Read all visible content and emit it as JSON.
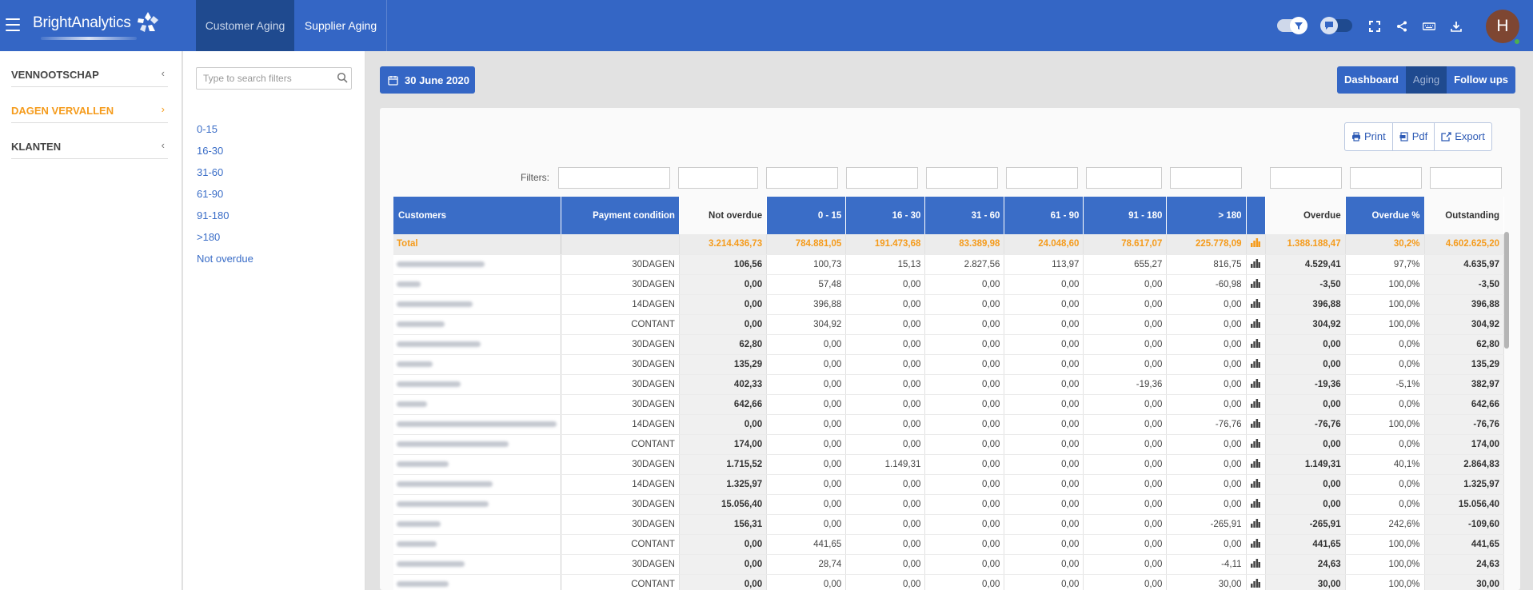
{
  "app": {
    "brand": "BrightAnalytics"
  },
  "nav": {
    "tabs": [
      {
        "label": "Customer Aging"
      },
      {
        "label": "Supplier Aging"
      }
    ]
  },
  "user": {
    "initial": "H"
  },
  "colors": {
    "primary": "#3466c5",
    "primary_dark": "#1f4a8f",
    "accent": "#f59b1b"
  },
  "sidebar": {
    "items": [
      {
        "label": "VENNOOTSCHAP",
        "chevron": "‹"
      },
      {
        "label": "DAGEN VERVALLEN",
        "chevron": "›"
      },
      {
        "label": "KLANTEN",
        "chevron": "‹"
      }
    ]
  },
  "filter_panel": {
    "search_placeholder": "Type to search filters",
    "options": [
      "0-15",
      "16-30",
      "31-60",
      "61-90",
      "91-180",
      ">180",
      "Not overdue"
    ]
  },
  "date_button": {
    "label": "30 June 2020"
  },
  "view_switch": {
    "items": [
      "Dashboard",
      "Aging",
      "Follow ups"
    ],
    "selected": "Aging"
  },
  "actions": {
    "print": "Print",
    "pdf": "Pdf",
    "export": "Export"
  },
  "filters_label": "Filters:",
  "table": {
    "columns": [
      "Customers",
      "Payment condition",
      "Not overdue",
      "0 - 15",
      "16 - 30",
      "31 - 60",
      "61 - 90",
      "91 - 180",
      "> 180",
      "",
      "Overdue",
      "Overdue %",
      "Outstanding"
    ],
    "total": {
      "label": "Total",
      "values": [
        "",
        "3.214.436,73",
        "784.881,05",
        "191.473,68",
        "83.389,98",
        "24.048,60",
        "78.617,07",
        "225.778,09",
        "1.388.188,47",
        "30,2%",
        "4.602.625,20"
      ]
    },
    "rows": [
      [
        "30DAGEN",
        "106,56",
        "100,73",
        "15,13",
        "2.827,56",
        "113,97",
        "655,27",
        "816,75",
        "4.529,41",
        "97,7%",
        "4.635,97"
      ],
      [
        "30DAGEN",
        "0,00",
        "57,48",
        "0,00",
        "0,00",
        "0,00",
        "0,00",
        "-60,98",
        "-3,50",
        "100,0%",
        "-3,50"
      ],
      [
        "14DAGEN",
        "0,00",
        "396,88",
        "0,00",
        "0,00",
        "0,00",
        "0,00",
        "0,00",
        "396,88",
        "100,0%",
        "396,88"
      ],
      [
        "CONTANT",
        "0,00",
        "304,92",
        "0,00",
        "0,00",
        "0,00",
        "0,00",
        "0,00",
        "304,92",
        "100,0%",
        "304,92"
      ],
      [
        "30DAGEN",
        "62,80",
        "0,00",
        "0,00",
        "0,00",
        "0,00",
        "0,00",
        "0,00",
        "0,00",
        "0,0%",
        "62,80"
      ],
      [
        "30DAGEN",
        "135,29",
        "0,00",
        "0,00",
        "0,00",
        "0,00",
        "0,00",
        "0,00",
        "0,00",
        "0,0%",
        "135,29"
      ],
      [
        "30DAGEN",
        "402,33",
        "0,00",
        "0,00",
        "0,00",
        "0,00",
        "-19,36",
        "0,00",
        "-19,36",
        "-5,1%",
        "382,97"
      ],
      [
        "30DAGEN",
        "642,66",
        "0,00",
        "0,00",
        "0,00",
        "0,00",
        "0,00",
        "0,00",
        "0,00",
        "0,0%",
        "642,66"
      ],
      [
        "14DAGEN",
        "0,00",
        "0,00",
        "0,00",
        "0,00",
        "0,00",
        "0,00",
        "-76,76",
        "-76,76",
        "100,0%",
        "-76,76"
      ],
      [
        "CONTANT",
        "174,00",
        "0,00",
        "0,00",
        "0,00",
        "0,00",
        "0,00",
        "0,00",
        "0,00",
        "0,0%",
        "174,00"
      ],
      [
        "30DAGEN",
        "1.715,52",
        "0,00",
        "1.149,31",
        "0,00",
        "0,00",
        "0,00",
        "0,00",
        "1.149,31",
        "40,1%",
        "2.864,83"
      ],
      [
        "14DAGEN",
        "1.325,97",
        "0,00",
        "0,00",
        "0,00",
        "0,00",
        "0,00",
        "0,00",
        "0,00",
        "0,0%",
        "1.325,97"
      ],
      [
        "30DAGEN",
        "15.056,40",
        "0,00",
        "0,00",
        "0,00",
        "0,00",
        "0,00",
        "0,00",
        "0,00",
        "0,0%",
        "15.056,40"
      ],
      [
        "30DAGEN",
        "156,31",
        "0,00",
        "0,00",
        "0,00",
        "0,00",
        "0,00",
        "-265,91",
        "-265,91",
        "242,6%",
        "-109,60"
      ],
      [
        "CONTANT",
        "0,00",
        "441,65",
        "0,00",
        "0,00",
        "0,00",
        "0,00",
        "0,00",
        "441,65",
        "100,0%",
        "441,65"
      ],
      [
        "30DAGEN",
        "0,00",
        "28,74",
        "0,00",
        "0,00",
        "0,00",
        "0,00",
        "-4,11",
        "24,63",
        "100,0%",
        "24,63"
      ],
      [
        "CONTANT",
        "0,00",
        "0,00",
        "0,00",
        "0,00",
        "0,00",
        "0,00",
        "30,00",
        "30,00",
        "100,0%",
        "30,00"
      ]
    ]
  }
}
